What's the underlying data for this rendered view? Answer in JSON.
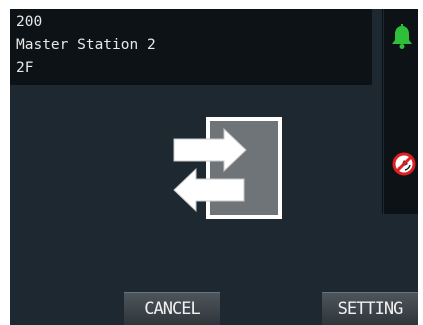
{
  "station": {
    "number": "200",
    "name": "Master Station 2",
    "floor": "2F"
  },
  "icons": {
    "status": "bell-icon",
    "mute": "mute-icon",
    "center": "transfer-icon"
  },
  "buttons": {
    "cancel_label": "CANCEL",
    "setting_label": "SETTING"
  },
  "colors": {
    "background": "#1d2830",
    "panel": "#0d1216",
    "bell": "#2fbf3a",
    "mute": "#e02020"
  }
}
